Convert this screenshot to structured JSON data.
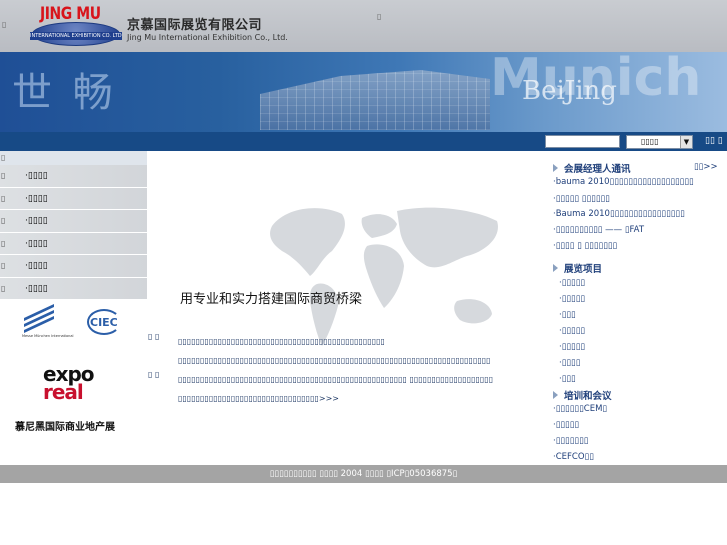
{
  "header": {
    "logo_brand": "JING MU",
    "logo_band": "INTERNATIONAL EXHIBITION CO. LTD.",
    "company_cn": "京慕国际展览有限公司",
    "company_en": "Jing Mu International Exhibition Co., Ltd.",
    "left_glyph": "▯",
    "right_glyph": "▯"
  },
  "banner": {
    "shibo": "世 畅",
    "munich": "Munich",
    "beijing": "BeiJing"
  },
  "search": {
    "input_value": "",
    "select_value": "▯▯▯▯",
    "go_label": "▯▯  ▯"
  },
  "leftnav": {
    "top_glyph": "▯",
    "items": [
      {
        "mark": "▯",
        "label": "·▯▯▯▯"
      },
      {
        "mark": "▯",
        "label": "·▯▯▯▯"
      },
      {
        "mark": "▯",
        "label": "·▯▯▯▯"
      },
      {
        "mark": "▯",
        "label": "·▯▯▯▯"
      },
      {
        "mark": "▯",
        "label": "·▯▯▯▯"
      },
      {
        "mark": "▯",
        "label": "·▯▯▯▯"
      }
    ],
    "partners": {
      "mm_caption": "Messe München International",
      "ciec": "CIEC",
      "expo_line1": "expo",
      "expo_line2": "real",
      "expo_caption": "慕尼黑国际商业地产展"
    }
  },
  "main": {
    "tagline": "用专业和实力搭建国际商贸桥梁",
    "para_mark": "▯ ▯",
    "lines": [
      "▯▯▯▯▯▯▯▯▯▯▯▯▯▯▯▯▯▯▯▯▯▯▯▯▯▯▯▯▯▯▯▯▯▯▯▯▯▯▯▯▯▯▯▯▯▯▯",
      "▯▯▯▯▯▯▯▯▯▯▯▯▯▯▯▯▯▯▯▯▯▯▯▯▯▯▯▯▯▯▯▯▯▯▯▯▯▯▯▯▯▯▯▯▯▯▯▯▯▯▯▯▯▯▯▯▯▯▯▯▯▯▯▯▯▯▯▯▯▯▯",
      "▯▯▯▯▯▯▯▯▯▯▯▯▯▯▯▯▯▯▯▯▯▯▯▯▯▯▯▯▯▯▯▯▯▯▯▯▯▯▯▯▯▯▯▯▯▯▯▯▯▯▯▯ ▯▯▯▯▯▯▯▯▯▯▯▯▯▯▯▯▯▯▯",
      "▯▯▯▯▯▯▯▯▯▯▯▯▯▯▯▯▯▯▯▯▯▯▯▯▯▯▯▯▯▯▯▯"
    ],
    "more": ">>>"
  },
  "rightcol": {
    "newsletter_title": "会展经理人通讯",
    "newsletter_more": "▯▯>>",
    "newsletter_items": [
      "·bauma 2010▯▯▯▯▯▯▯▯▯▯▯▯▯▯▯▯▯▯",
      "·▯▯▯▯▯ ▯▯▯▯▯▯",
      "·Bauma 2010▯▯▯▯▯▯▯▯▯▯▯▯▯▯▯▯",
      "·▯▯▯▯▯▯▯▯▯▯ —— ▯FAT",
      "·▯▯▯▯ ▯ ▯▯▯▯▯▯▯"
    ],
    "projects_title": "展览项目",
    "project_items": [
      "·▯▯▯▯▯",
      "·▯▯▯▯▯",
      "·▯▯▯",
      "·▯▯▯▯▯",
      "·▯▯▯▯▯",
      "·▯▯▯▯",
      "·▯▯▯"
    ],
    "training_title": "培训和会议",
    "training_items": [
      "·▯▯▯▯▯▯CEM▯",
      "·▯▯▯▯▯",
      "·▯▯▯▯▯▯▯",
      "·CEFCO▯▯"
    ]
  },
  "footer": {
    "text": "▯▯▯▯▯▯▯▯▯▯ ▯▯▯▯ 2004 ▯▯▯▯ ▯ICP▯05036875▯"
  }
}
